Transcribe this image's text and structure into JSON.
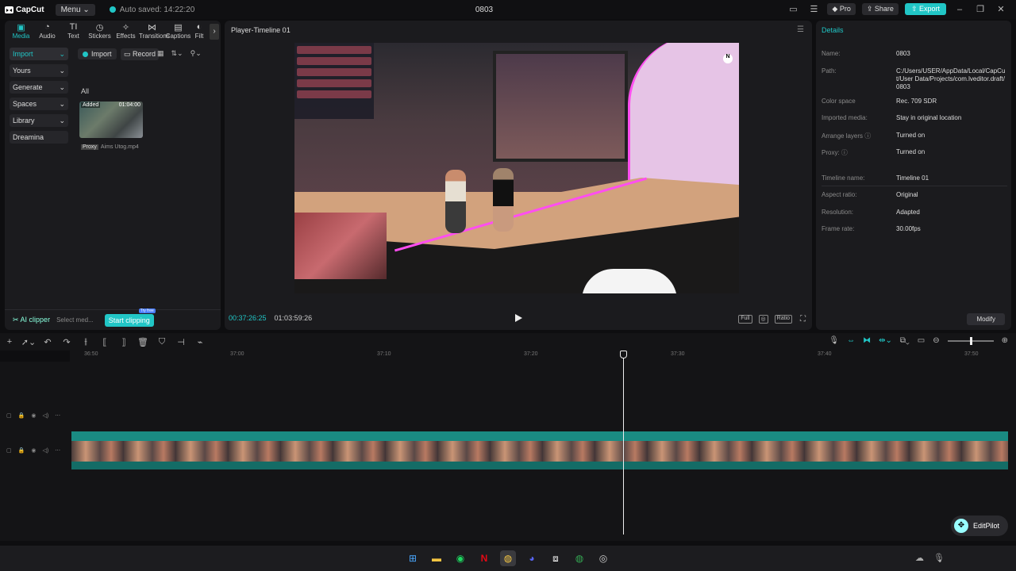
{
  "app": {
    "logo": "CapCut",
    "menu_label": "Menu",
    "autosave": "Auto saved: 14:22:20",
    "project_title": "0803",
    "pro_label": "Pro",
    "share_label": "Share",
    "export_label": "Export",
    "accent_color": "#21c6c6"
  },
  "tabs": [
    {
      "label": "Media",
      "icon": "media-icon"
    },
    {
      "label": "Audio",
      "icon": "audio-icon"
    },
    {
      "label": "Text",
      "icon": "text-icon"
    },
    {
      "label": "Stickers",
      "icon": "stickers-icon"
    },
    {
      "label": "Effects",
      "icon": "effects-icon"
    },
    {
      "label": "Transitions",
      "icon": "transitions-icon"
    },
    {
      "label": "Captions",
      "icon": "captions-icon"
    },
    {
      "label": "Filt",
      "icon": "filters-icon"
    }
  ],
  "sidenav": [
    "Import",
    "Yours",
    "Generate",
    "Spaces",
    "Library",
    "Dreamina"
  ],
  "media": {
    "import_label": "Import",
    "record_label": "Record",
    "all_label": "All",
    "clip_added": "Added",
    "clip_duration": "01:04:00",
    "clip_proxy": "Proxy",
    "clip_name": "Aims Utog.mp4"
  },
  "aiclipper": {
    "label": "AI clipper",
    "select": "Select med...",
    "start": "Start clipping",
    "badge": "Try free"
  },
  "player": {
    "title": "Player-Timeline 01",
    "current_time": "00:37:26:25",
    "total_time": "01:03:59:26",
    "full_label": "Full",
    "ratio_label": "Ratio"
  },
  "details": {
    "title": "Details",
    "rows": [
      {
        "k": "Name:",
        "v": "0803"
      },
      {
        "k": "Path:",
        "v": "C:/Users/USER/AppData/Local/CapCut/User Data/Projects/com.lveditor.draft/0803"
      },
      {
        "k": "Color space",
        "v": "Rec. 709 SDR"
      },
      {
        "k": "Imported media:",
        "v": "Stay in original location"
      },
      {
        "k": "Arrange layers",
        "v": "Turned on"
      },
      {
        "k": "Proxy:",
        "v": "Turned on"
      },
      {
        "k": "Timeline name:",
        "v": "Timeline 01"
      },
      {
        "k": "Aspect ratio:",
        "v": "Original"
      },
      {
        "k": "Resolution:",
        "v": "Adapted"
      },
      {
        "k": "Frame rate:",
        "v": "30.00fps"
      }
    ],
    "modify_label": "Modify"
  },
  "ruler": [
    "36:50",
    "37:00",
    "37:10",
    "37:20",
    "37:30",
    "37:40",
    "37:50"
  ],
  "editpilot": "EditPilot"
}
